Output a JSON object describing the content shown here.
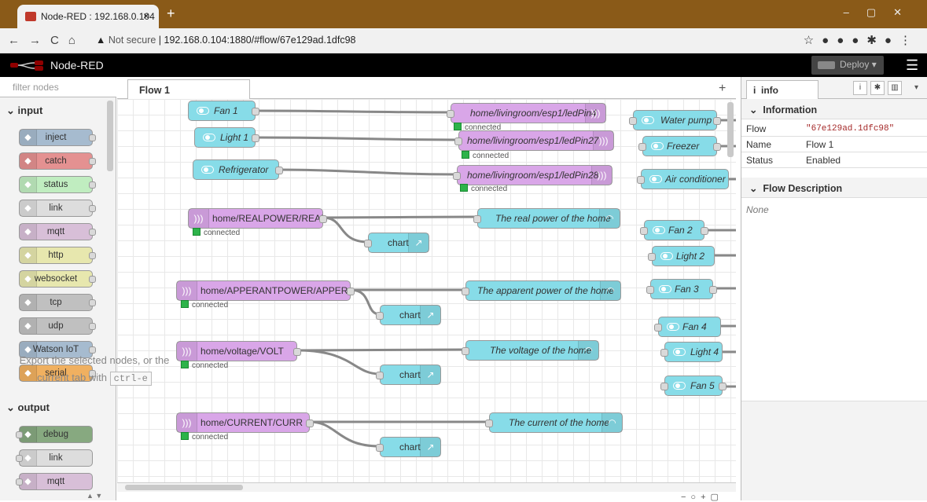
{
  "browser": {
    "tab_title": "Node-RED : 192.168.0.104",
    "new_tab": "+",
    "security": "Not secure",
    "url": "192.168.0.104:1880/#flow/67e129ad.1dfc98"
  },
  "header": {
    "brand": "Node-RED",
    "deploy_label": "Deploy",
    "colors": {
      "bar": "#000000",
      "deploy": "#444444"
    }
  },
  "palette": {
    "filter_placeholder": "filter nodes",
    "input_category": "input",
    "output_category": "output",
    "input_nodes": [
      {
        "label": "inject",
        "color": "#a6bbcf"
      },
      {
        "label": "catch",
        "color": "#e49191"
      },
      {
        "label": "status",
        "color": "#c0edc0"
      },
      {
        "label": "link",
        "color": "#dddddd"
      },
      {
        "label": "mqtt",
        "color": "#d8bfd8"
      },
      {
        "label": "http",
        "color": "#e7e7ae"
      },
      {
        "label": "websocket",
        "color": "#e7e7ae"
      },
      {
        "label": "tcp",
        "color": "#c0c0c0"
      },
      {
        "label": "udp",
        "color": "#c0c0c0"
      },
      {
        "label": "Watson IoT",
        "color": "#a6bbcf"
      },
      {
        "label": "serial",
        "color": "#f0b060"
      }
    ],
    "output_nodes": [
      {
        "label": "debug",
        "color": "#87a980"
      },
      {
        "label": "link",
        "color": "#dddddd"
      },
      {
        "label": "mqtt",
        "color": "#d8bfd8"
      }
    ]
  },
  "workspace": {
    "flow_tab": "Flow 1",
    "nodes": {
      "fan1": "Fan 1",
      "light1": "Light 1",
      "refrigerator": "Refrigerator",
      "led4": "home/livingroom/esp1/ledPin4",
      "led27": "home/livingroom/esp1/ledPin27",
      "led28": "home/livingroom/esp1/ledPin28",
      "water_pump": "Water pump",
      "freezer": "Freezer",
      "air_conditioner": "Air conditioner",
      "realpower": "home/REALPOWER/REAL",
      "apparent": "home/APPERANTPOWER/APPER",
      "voltage": "home/voltage/VOLT",
      "current": "home/CURRENT/CURR",
      "gauge_real": "The real power of the home",
      "gauge_apparent": "The apparent power of the home",
      "gauge_voltage": "The voltage of the home",
      "gauge_current": "The current of the home",
      "chart": "chart",
      "fan2": "Fan 2",
      "light2": "Light 2",
      "fan3": "Fan 3",
      "fan4": "Fan 4",
      "light4": "Light 4",
      "fan5": "Fan 5"
    },
    "status_connected": "connected"
  },
  "sidebar": {
    "tab": "info",
    "information_header": "Information",
    "rows": [
      {
        "key": "Flow",
        "value": "\"67e129ad.1dfc98\""
      },
      {
        "key": "Name",
        "value": "Flow 1"
      },
      {
        "key": "Status",
        "value": "Enabled"
      }
    ],
    "flow_description_header": "Flow Description",
    "flow_description": "None",
    "hint_text": "Export the selected nodes, or the current tab with",
    "hint_key": "ctrl-e"
  }
}
